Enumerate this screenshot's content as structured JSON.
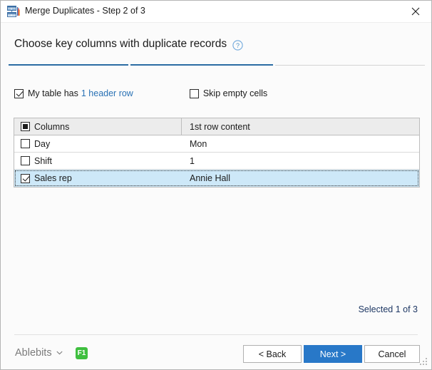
{
  "window": {
    "title": "Merge Duplicates - Step 2 of 3",
    "icon": "merge-tables-icon",
    "close_label": "✕"
  },
  "heading": {
    "text": "Choose key columns with duplicate records",
    "help_icon": "help-circle-icon"
  },
  "steps": {
    "total": 3,
    "current": 2,
    "segments": [
      "done",
      "done",
      "todo"
    ],
    "done_color": "#2b6ca3",
    "todo_color": "#d3d3d3"
  },
  "options": {
    "my_table_has": {
      "label": "My table has",
      "link_label": "1 header row",
      "checked": true
    },
    "skip_empty_cells": {
      "label": "Skip empty cells",
      "checked": false
    }
  },
  "table": {
    "headers": {
      "columns": "Columns",
      "first_row_content": "1st row content"
    },
    "header_checkbox_state": "indeterminate",
    "rows": [
      {
        "name": "Day",
        "content": "Mon",
        "checked": false,
        "selected": false
      },
      {
        "name": "Shift",
        "content": "1",
        "checked": false,
        "selected": false
      },
      {
        "name": "Sales rep",
        "content": "Annie Hall",
        "checked": true,
        "selected": true
      }
    ]
  },
  "status": {
    "text": "Selected 1 of 3",
    "color": "#1f3864"
  },
  "footer": {
    "brand": "Ablebits",
    "brand_caret": "⌄",
    "help_key_badge": "F1",
    "badge_color": "#3fbf3f",
    "buttons": {
      "back": "< Back",
      "next": "Next >",
      "cancel": "Cancel"
    },
    "primary_color": "#2878c8"
  }
}
